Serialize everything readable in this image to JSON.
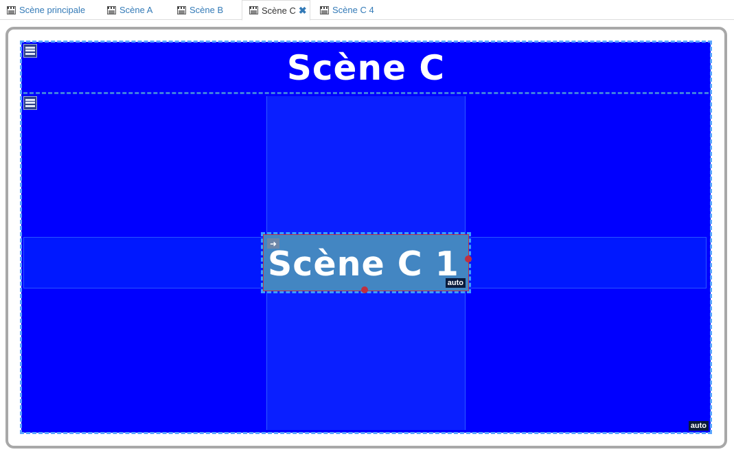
{
  "tabs": [
    {
      "label": "Scène principale",
      "active": false
    },
    {
      "label": "Scène A",
      "active": false
    },
    {
      "label": "Scène B",
      "active": false
    },
    {
      "label": "Scène C",
      "active": true
    },
    {
      "label": "Scène C 4",
      "active": false
    }
  ],
  "stage": {
    "header_title": "Scène C",
    "selected_title": "Scène C 1",
    "selected_badge": "auto",
    "stage_badge": "auto"
  },
  "colors": {
    "stage_background": "#0000ff",
    "selection_fill": "#4386c2",
    "tab_link": "#337ab7",
    "frame_border": "#a8a8a8"
  },
  "icons": {
    "tab": "clapperboard-icon",
    "close": "close-icon",
    "menu": "menu-icon",
    "arrow": "arrow-right-icon"
  }
}
